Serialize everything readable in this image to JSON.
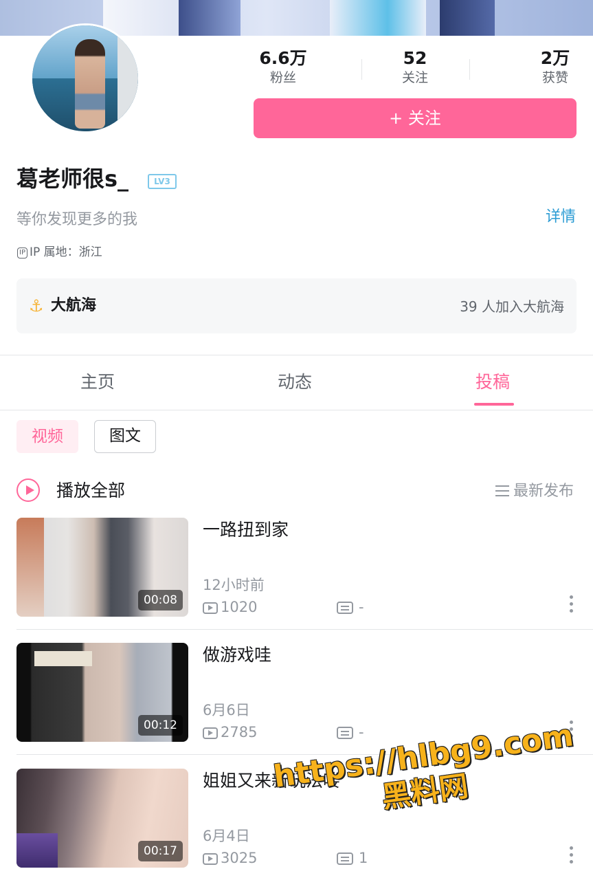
{
  "profile": {
    "name": "葛老师很s_",
    "level": "LV3",
    "signature": "等你发现更多的我",
    "detail_link": "详情",
    "ip_icon": "IP",
    "ip_location": "IP 属地：浙江"
  },
  "stats": [
    {
      "value": "6.6万",
      "label": "粉丝"
    },
    {
      "value": "52",
      "label": "关注"
    },
    {
      "value": "2万",
      "label": "获赞"
    }
  ],
  "follow_button": "+ 关注",
  "voyage": {
    "title": "大航海",
    "count": "39 人加入大航海",
    "icon_color": "#f6b53c"
  },
  "tabs": [
    {
      "label": "主页",
      "active": false
    },
    {
      "label": "动态",
      "active": false
    },
    {
      "label": "投稿",
      "active": true
    }
  ],
  "filter_chips": [
    {
      "label": "视频",
      "active": true
    },
    {
      "label": "图文",
      "active": false
    }
  ],
  "play_all": {
    "label": "播放全部"
  },
  "sort": {
    "label": "最新发布"
  },
  "videos": [
    {
      "title": "一路扭到家",
      "duration": "00:08",
      "time": "12小时前",
      "plays": "1020",
      "comments": "-"
    },
    {
      "title": "做游戏哇",
      "duration": "00:12",
      "time": "6月6日",
      "plays": "2785",
      "comments": "-"
    },
    {
      "title": "姐姐又来新玩法喽",
      "duration": "00:17",
      "time": "6月4日",
      "plays": "3025",
      "comments": "1"
    }
  ],
  "watermark": {
    "line1": "https://hlbg9.com",
    "line2": "黑料网"
  },
  "colors": {
    "accent": "#ff6699",
    "link": "#2a9bd3",
    "muted": "#9499a0",
    "level": "#7ec8ea"
  }
}
